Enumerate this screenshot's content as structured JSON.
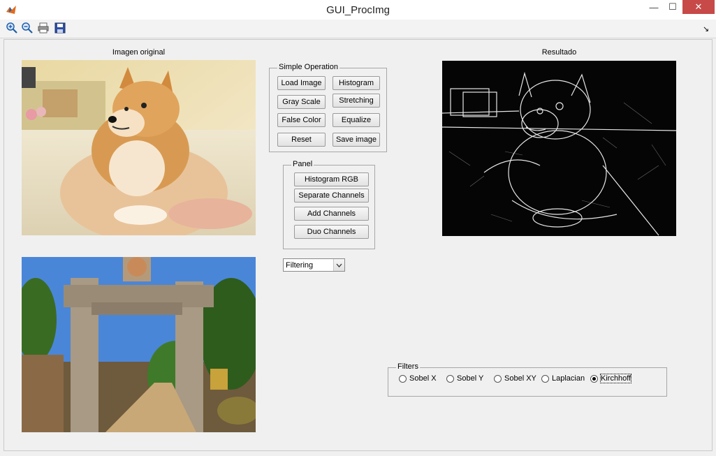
{
  "window": {
    "title": "GUI_ProcImg",
    "minimize": "—",
    "maximize": "☐",
    "close": "✕"
  },
  "toolbar": {
    "zoom_in_icon": "zoom-in-icon",
    "zoom_out_icon": "zoom-out-icon",
    "print_icon": "print-icon",
    "save_icon": "save-icon",
    "dock_arrow": "↘"
  },
  "original": {
    "title": "Imagen original"
  },
  "result": {
    "title": "Resultado"
  },
  "simple_operation": {
    "label": "Simple Operation",
    "buttons": [
      "Load Image",
      "Histogram",
      "Gray Scale",
      "Stretching",
      "False Color",
      "Equalize",
      "Reset",
      "Save image"
    ]
  },
  "panel": {
    "label": "Panel",
    "buttons": [
      "Histogram RGB",
      "Separate Channels",
      "Add Channels",
      "Duo Channels"
    ]
  },
  "filter_select": {
    "value": "Filtering",
    "arrow": "⌄"
  },
  "filters": {
    "label": "Filters",
    "options": [
      "Sobel X",
      "Sobel Y",
      "Sobel XY",
      "Laplacian",
      "Kirchhoff"
    ],
    "selected": "Kirchhoff"
  },
  "colors": {
    "background": "#f0f0f0",
    "close_button": "#c74a48"
  }
}
